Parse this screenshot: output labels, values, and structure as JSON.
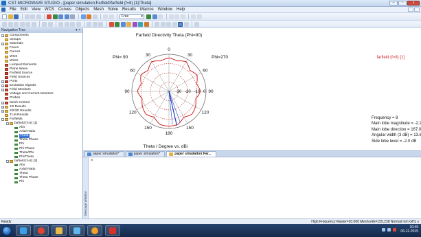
{
  "window": {
    "title": "CST MICROWAVE STUDIO - [paper simulation:Farfield\\farfield (f=8) [1]\\Theta]",
    "controls": [
      "–",
      "▫",
      "x"
    ]
  },
  "menu": {
    "items": [
      "File",
      "Edit",
      "View",
      "WCS",
      "Curves",
      "Objects",
      "Mesh",
      "Solve",
      "Results",
      "Macros",
      "Window",
      "Help"
    ]
  },
  "toolbar": {
    "mode_combo": "Free"
  },
  "nav": {
    "header": "Navigation Tree",
    "pin": "▾ ×",
    "items": [
      {
        "label": "Components",
        "exp": "+",
        "kind": "folder"
      },
      {
        "label": "Groups",
        "exp": "",
        "kind": "folder"
      },
      {
        "label": "Materials",
        "exp": "+",
        "kind": "folder"
      },
      {
        "label": "Faces",
        "exp": "",
        "kind": "folder"
      },
      {
        "label": "Curves",
        "exp": "",
        "kind": "folder"
      },
      {
        "label": "WCS",
        "exp": "",
        "kind": "folder"
      },
      {
        "label": "Wires",
        "exp": "",
        "kind": "folder"
      },
      {
        "label": "Lumped Elements",
        "exp": "",
        "kind": "red"
      },
      {
        "label": "Plane Wave",
        "exp": "",
        "kind": "red"
      },
      {
        "label": "Farfield Source",
        "exp": "",
        "kind": "red"
      },
      {
        "label": "Field Sources",
        "exp": "",
        "kind": "red"
      },
      {
        "label": "Ports",
        "exp": "+",
        "kind": "red"
      },
      {
        "label": "Excitation Signals",
        "exp": "+",
        "kind": "red"
      },
      {
        "label": "Field Monitors",
        "exp": "+",
        "kind": "red"
      },
      {
        "label": "Voltage and Current Monitors",
        "exp": "",
        "kind": "red"
      },
      {
        "label": "Probes",
        "exp": "",
        "kind": "red"
      },
      {
        "label": "Mesh Control",
        "exp": "+",
        "kind": "red"
      },
      {
        "label": "1D Results",
        "exp": "+",
        "kind": "folder"
      },
      {
        "label": "2D/3D Results",
        "exp": "+",
        "kind": "folder"
      },
      {
        "label": "TLM Results",
        "exp": "",
        "kind": "folder"
      },
      {
        "label": "Farfields",
        "exp": "-",
        "kind": "folder"
      },
      {
        "label": "farfield (f=8) [1]",
        "exp": "-",
        "kind": "folder",
        "indent": 1
      },
      {
        "label": "Abs",
        "exp": "",
        "kind": "leaf",
        "indent": 2
      },
      {
        "label": "Axial Ratio",
        "exp": "",
        "kind": "leaf",
        "indent": 2
      },
      {
        "label": "Theta",
        "exp": "",
        "kind": "leaf",
        "indent": 2,
        "selected": true
      },
      {
        "label": "Theta Phase",
        "exp": "",
        "kind": "leaf",
        "indent": 2
      },
      {
        "label": "Phi",
        "exp": "",
        "kind": "leaf",
        "indent": 2
      },
      {
        "label": "Phi Phase",
        "exp": "",
        "kind": "leaf",
        "indent": 2
      },
      {
        "label": "Theta/Phi",
        "exp": "",
        "kind": "leaf",
        "indent": 2
      },
      {
        "label": "Phi/Theta",
        "exp": "",
        "kind": "leaf",
        "indent": 2
      },
      {
        "label": "farfield (f=8) [2]",
        "exp": "-",
        "kind": "folder",
        "indent": 1
      },
      {
        "label": "Abs",
        "exp": "",
        "kind": "leaf",
        "indent": 2
      },
      {
        "label": "Axial Ratio",
        "exp": "",
        "kind": "leaf",
        "indent": 2
      },
      {
        "label": "Theta",
        "exp": "",
        "kind": "leaf",
        "indent": 2
      },
      {
        "label": "Theta Phase",
        "exp": "",
        "kind": "leaf",
        "indent": 2
      },
      {
        "label": "Phi",
        "exp": "",
        "kind": "leaf",
        "indent": 2
      }
    ]
  },
  "plot": {
    "title": "Farfield Directivity Theta (Phi=90)",
    "footer": "Theta / Degree vs. dBi",
    "legend": "farfield (f=8) [1]",
    "phi_left": "Phi= 90",
    "phi_right": "Phi=270",
    "angle_labels": [
      "0",
      "30",
      "30",
      "60",
      "60",
      "90",
      "90",
      "120",
      "120",
      "150",
      "150",
      "180"
    ],
    "radial_labels": [
      "-30",
      "-20",
      "-10",
      "0"
    ],
    "info": [
      "Frequency = 8",
      "Main lobe magnitude =   -2.2 dBi",
      "Main lobe direction =  167.0 deg.",
      "Angular width (3 dB) =  13.6 deg.",
      "Side lobe level =   -2.0 dB"
    ],
    "colors": {
      "curve": "#cc2222",
      "grid_dash": "#cc2222",
      "main_lobe": "#1a3fbf",
      "grid": "#777777"
    }
  },
  "chart_data": {
    "type": "polar",
    "title": "Farfield Directivity Theta (Phi=90)",
    "xlabel": "Theta / Degree vs. dBi",
    "radial_range": [
      -40,
      0
    ],
    "radial_ticks": [
      -30,
      -20,
      -10,
      0
    ],
    "series": [
      {
        "name": "farfield (f=8) [1]",
        "theta_deg": [
          0,
          15,
          30,
          45,
          60,
          75,
          90,
          105,
          120,
          135,
          150,
          165,
          180,
          195,
          210,
          225,
          240,
          255,
          270,
          285,
          300,
          315,
          330,
          345
        ],
        "values_dbi": [
          -4,
          -6,
          -3,
          -8,
          -5,
          -9,
          -6,
          -10,
          -7,
          -5,
          -8,
          -3,
          -2.5,
          -3,
          -8,
          -5,
          -7,
          -10,
          -6,
          -9,
          -5,
          -8,
          -3,
          -6
        ]
      }
    ],
    "main_lobe_direction_deg": 167.0,
    "main_lobe_magnitude_dbi": -2.2
  },
  "tabs": [
    {
      "label": "paper simulation*"
    },
    {
      "label": "paper simulation*"
    },
    {
      "label": "paper simulation:Far...",
      "active": true
    }
  ],
  "message_window": {
    "title": "Message Window",
    "close": "×"
  },
  "status": {
    "left": "Ready",
    "right": "High Frequency   Raster=20.000   Meshcells=155,238   Normal   mm   GHz   s"
  },
  "taskbar": {
    "time": "10:49",
    "date": "06-12-2015"
  }
}
